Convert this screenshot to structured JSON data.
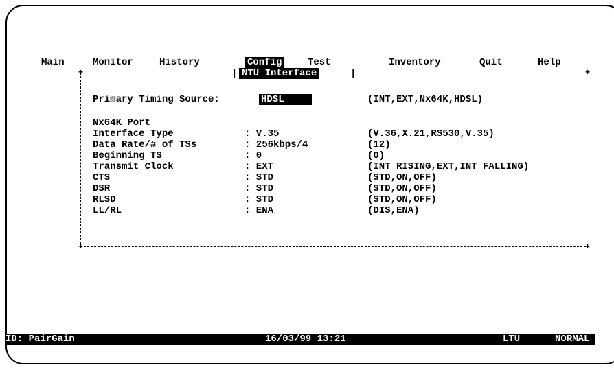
{
  "menu": {
    "items": [
      {
        "label": "Main"
      },
      {
        "label": "Monitor"
      },
      {
        "label": "History"
      },
      {
        "label": "Config"
      },
      {
        "label": "Test"
      },
      {
        "label": "Inventory"
      },
      {
        "label": "Quit"
      },
      {
        "label": "Help"
      }
    ],
    "active": "Config"
  },
  "panel": {
    "title": "NTU Interface",
    "primary_timing": {
      "label": "Primary Timing Source:",
      "value": "HDSL",
      "options": "(INT,EXT,Nx64K,HDSL)"
    },
    "section_header": "Nx64K Port",
    "rows": [
      {
        "label": "Interface Type",
        "value": ": V.35",
        "options": "(V.36,X.21,RS530,V.35)"
      },
      {
        "label": "Data Rate/# of TSs",
        "value": ": 256kbps/4",
        "options": "(12)"
      },
      {
        "label": "Beginning TS",
        "value": ": 0",
        "options": "(0)"
      },
      {
        "label": "Transmit Clock",
        "value": ": EXT",
        "options": "(INT_RISING,EXT,INT_FALLING)"
      },
      {
        "label": "CTS",
        "value": ": STD",
        "options": "(STD,ON,OFF)"
      },
      {
        "label": "DSR",
        "value": ": STD",
        "options": "(STD,ON,OFF)"
      },
      {
        "label": "RLSD",
        "value": ": STD",
        "options": "(STD,ON,OFF)"
      },
      {
        "label": "LL/RL",
        "value": ": ENA",
        "options": "(DIS,ENA)"
      }
    ]
  },
  "status_bar": {
    "id": "ID: PairGain",
    "datetime": "16/03/99 13:21",
    "unit": "LTU",
    "state": "NORMAL"
  }
}
